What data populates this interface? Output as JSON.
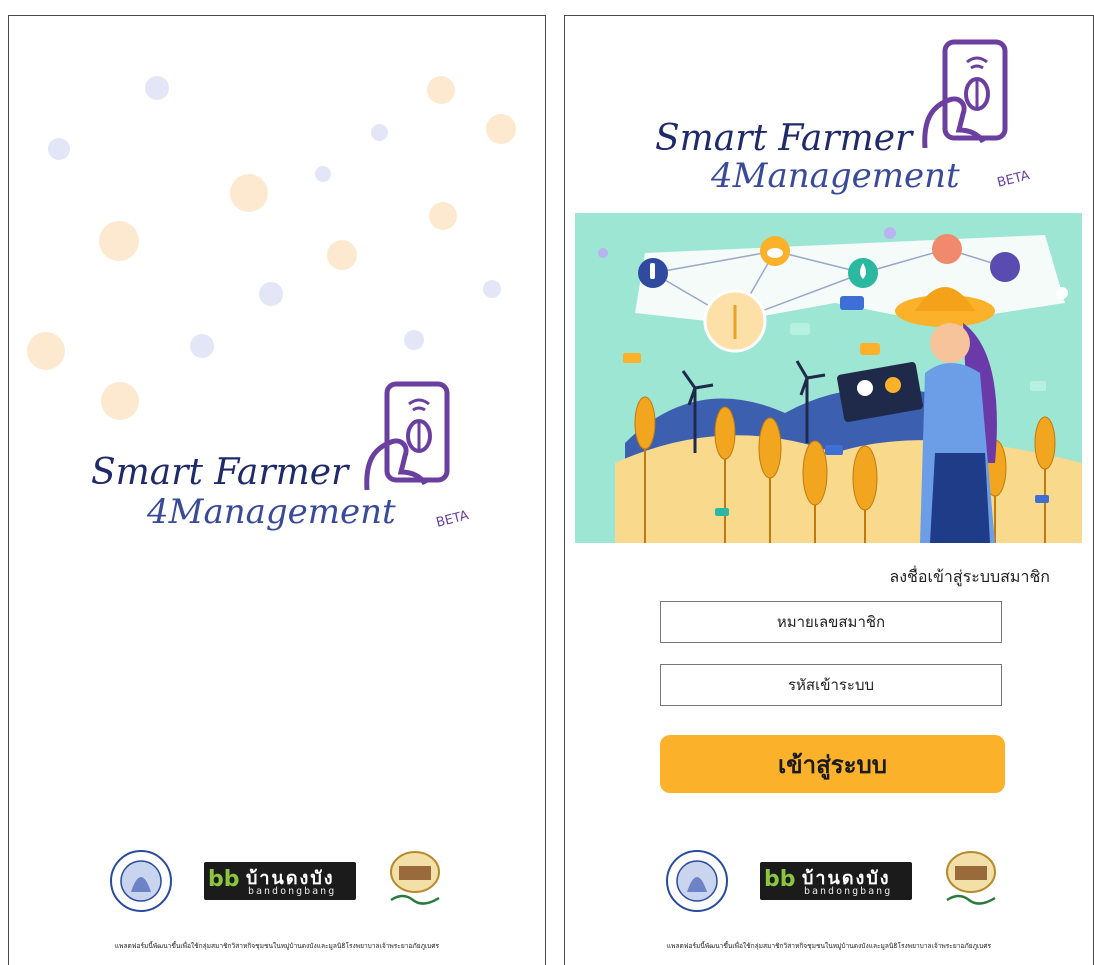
{
  "brand": {
    "line1": "Smart Farmer",
    "line2": "4Management",
    "beta": "BETA",
    "primary_color": "#1f2a6b",
    "accent_color": "#6b3fa0"
  },
  "splash": {
    "dot_colors": [
      "#e3e6f6",
      "#fde9cf"
    ]
  },
  "login": {
    "title": "ลงชื่อเข้าสู่ระบบสมาชิก",
    "member_id_placeholder": "หมายเลขสมาชิก",
    "password_placeholder": "รหัสเข้าระบบ",
    "submit_label": "เข้าสู่ระบบ",
    "button_color": "#fbb12a",
    "hero_bg": "#9de6d4"
  },
  "partners": {
    "bandongbang_thai": "บ้านดงบัง",
    "bandongbang_latin": "bandongbang",
    "bdb_mark": "bb"
  },
  "footer": {
    "text": "แพลตฟอร์มนี้พัฒนาขึ้นเพื่อใช้กลุ่มสมาชิกวิสาหกิจชุมชนในหมู่บ้านดงบังและมูลนิธิโรงพยาบาลเจ้าพระยาอภัยภูเบศร"
  }
}
